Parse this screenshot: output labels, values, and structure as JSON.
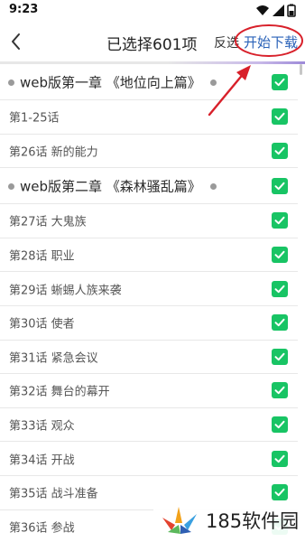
{
  "status_bar": {
    "time": "9:23"
  },
  "header": {
    "back_icon": "chevron-left-icon",
    "title": "已选择601项",
    "invert_label": "反选",
    "download_label": "开始下载"
  },
  "list": [
    {
      "type": "chapter",
      "label": "web版第一章 《地位向上篇》",
      "checked": true
    },
    {
      "type": "episode",
      "label": "第1-25话",
      "checked": true
    },
    {
      "type": "episode",
      "label": "第26话 新的能力",
      "checked": true
    },
    {
      "type": "chapter",
      "label": "web版第二章 《森林骚乱篇》",
      "checked": true
    },
    {
      "type": "episode",
      "label": "第27话 大鬼族",
      "checked": true
    },
    {
      "type": "episode",
      "label": "第28话 职业",
      "checked": true
    },
    {
      "type": "episode",
      "label": "第29话 蜥蜴人族来袭",
      "checked": true
    },
    {
      "type": "episode",
      "label": "第30话 使者",
      "checked": true
    },
    {
      "type": "episode",
      "label": "第31话 紧急会议",
      "checked": true
    },
    {
      "type": "episode",
      "label": "第32话 舞台的幕开",
      "checked": true
    },
    {
      "type": "episode",
      "label": "第33话 观众",
      "checked": true
    },
    {
      "type": "episode",
      "label": "第34话 开战",
      "checked": true
    },
    {
      "type": "episode",
      "label": "第35话 战斗准备",
      "checked": true
    },
    {
      "type": "episode",
      "label": "第36话 参战",
      "checked": true
    }
  ],
  "colors": {
    "checkbox": "#18c464",
    "download_text": "#2a62b8",
    "annotation": "#d8202a"
  },
  "watermark": {
    "text": "185软件园"
  }
}
